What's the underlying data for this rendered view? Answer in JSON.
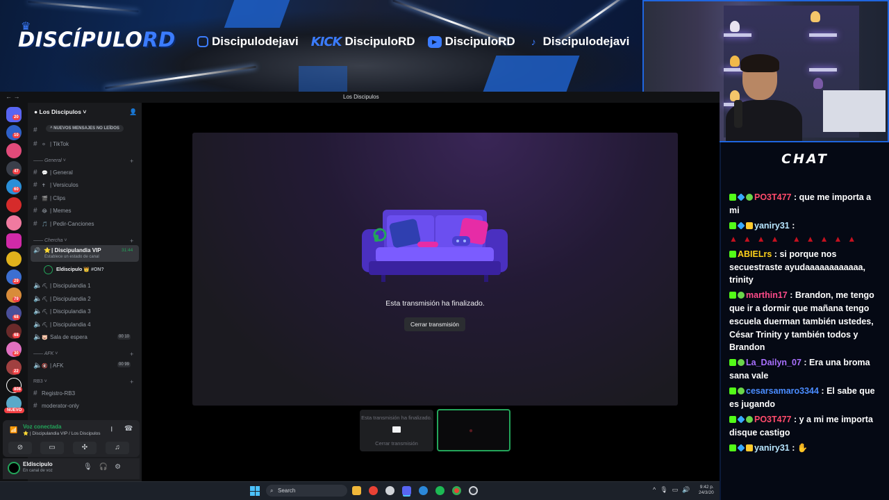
{
  "banner": {
    "logo_main": "DISCÍPULO",
    "logo_accent": "RD",
    "socials": [
      {
        "icon": "instagram-icon",
        "handle": "Discipulodejavi"
      },
      {
        "icon": "kick-icon",
        "label": "KICK",
        "handle": "DiscipuloRD"
      },
      {
        "icon": "youtube-icon",
        "handle": "DiscipuloRD"
      },
      {
        "icon": "tiktok-icon",
        "handle": "Discipulodejavi"
      }
    ]
  },
  "chat": {
    "title": "CHAT",
    "messages": [
      {
        "user": "PO3T477",
        "color": "#ff4b6b",
        "text": "que me importa a mi"
      },
      {
        "user": "yaniry31",
        "color": "#b8e6ff",
        "text": ""
      },
      {
        "user": "ABIELrs",
        "color": "#ffd11a",
        "text": "si porque nos secuestraste ayudaaaaaaaaaaaa, trinity"
      },
      {
        "user": "marthin17",
        "color": "#ff4b8a",
        "text": "Brandon, me tengo que ir a dormir que mañana tengo escuela duerman también ustedes, César Trinity y también todos y Brandon"
      },
      {
        "user": "La_Dailyn_07",
        "color": "#a970ff",
        "text": "Era una broma sana vale"
      },
      {
        "user": "cesarsamaro3344",
        "color": "#4a8cff",
        "text": "El sabe que es jugando"
      },
      {
        "user": "PO3T477",
        "color": "#ff4b6b",
        "text": "y a mi me importa disque castigo"
      },
      {
        "user": "yaniry31",
        "color": "#b8e6ff",
        "text": ""
      }
    ]
  },
  "discord": {
    "window_title": "Los Discipulos",
    "guild_name": "Los Discipulos",
    "unread_pill": "NUEVOS MENSAJES NO LEÍDOS",
    "channels": [
      {
        "type": "text",
        "emoji": "⚪",
        "name": "| TikTok"
      },
      {
        "type": "category",
        "name": "General"
      },
      {
        "type": "text",
        "emoji": "💬",
        "name": "| General"
      },
      {
        "type": "text",
        "emoji": "✝",
        "name": "| Versiculos"
      },
      {
        "type": "text",
        "emoji": "🎬",
        "name": "| Clips"
      },
      {
        "type": "text",
        "emoji": "😂",
        "name": "| Memes"
      },
      {
        "type": "text",
        "emoji": "🎵",
        "name": "| Pedir-Canciones"
      },
      {
        "type": "category",
        "name": "Chercha"
      }
    ],
    "vip_channel": {
      "name": "| Discipulandia VIP",
      "time": "31:44",
      "status": "Establece un estado de canal"
    },
    "vip_user": {
      "name": "Eldiscipulo",
      "tag": "👑 #ON?"
    },
    "voice_channels": [
      {
        "name": "| Discipulandia 1",
        "count": ""
      },
      {
        "name": "| Discipulandia 2",
        "count": ""
      },
      {
        "name": "| Discipulandia 3",
        "count": ""
      },
      {
        "name": "| Discipulandia 4",
        "count": ""
      },
      {
        "name": "Sala de espera",
        "count": "00 10"
      }
    ],
    "afk": {
      "category": "AFK",
      "name": "| AFK",
      "count": "00 99"
    },
    "rb3": {
      "category": "RB3",
      "items": [
        "Registro-RB3",
        "moderator-only"
      ]
    },
    "server_badges": [
      "20",
      "10",
      "47",
      "60",
      "29",
      "68",
      "79",
      "68",
      "30",
      "22",
      "808"
    ],
    "nuevo": "NUEVO",
    "voice_connected": {
      "title": "Voz conectada",
      "subtitle": "| Discipulandia VIP / Los Discipulos"
    },
    "user": {
      "name": "Eldiscipulo",
      "status": "En canal de voz"
    },
    "stream": {
      "ended_text": "Esta transmisión ha finalizado.",
      "close_button": "Cerrar transmisión",
      "thumb_text": "Esta transmisión ha finalizado.",
      "thumb_button": "Cerrar transmisión"
    }
  },
  "taskbar": {
    "search_placeholder": "Search",
    "time": "9:42 p.",
    "date": "24/3/20"
  },
  "colors": {
    "accent": "#3b7cff",
    "discord_green": "#23a55a",
    "kick_green": "#53fc18"
  }
}
